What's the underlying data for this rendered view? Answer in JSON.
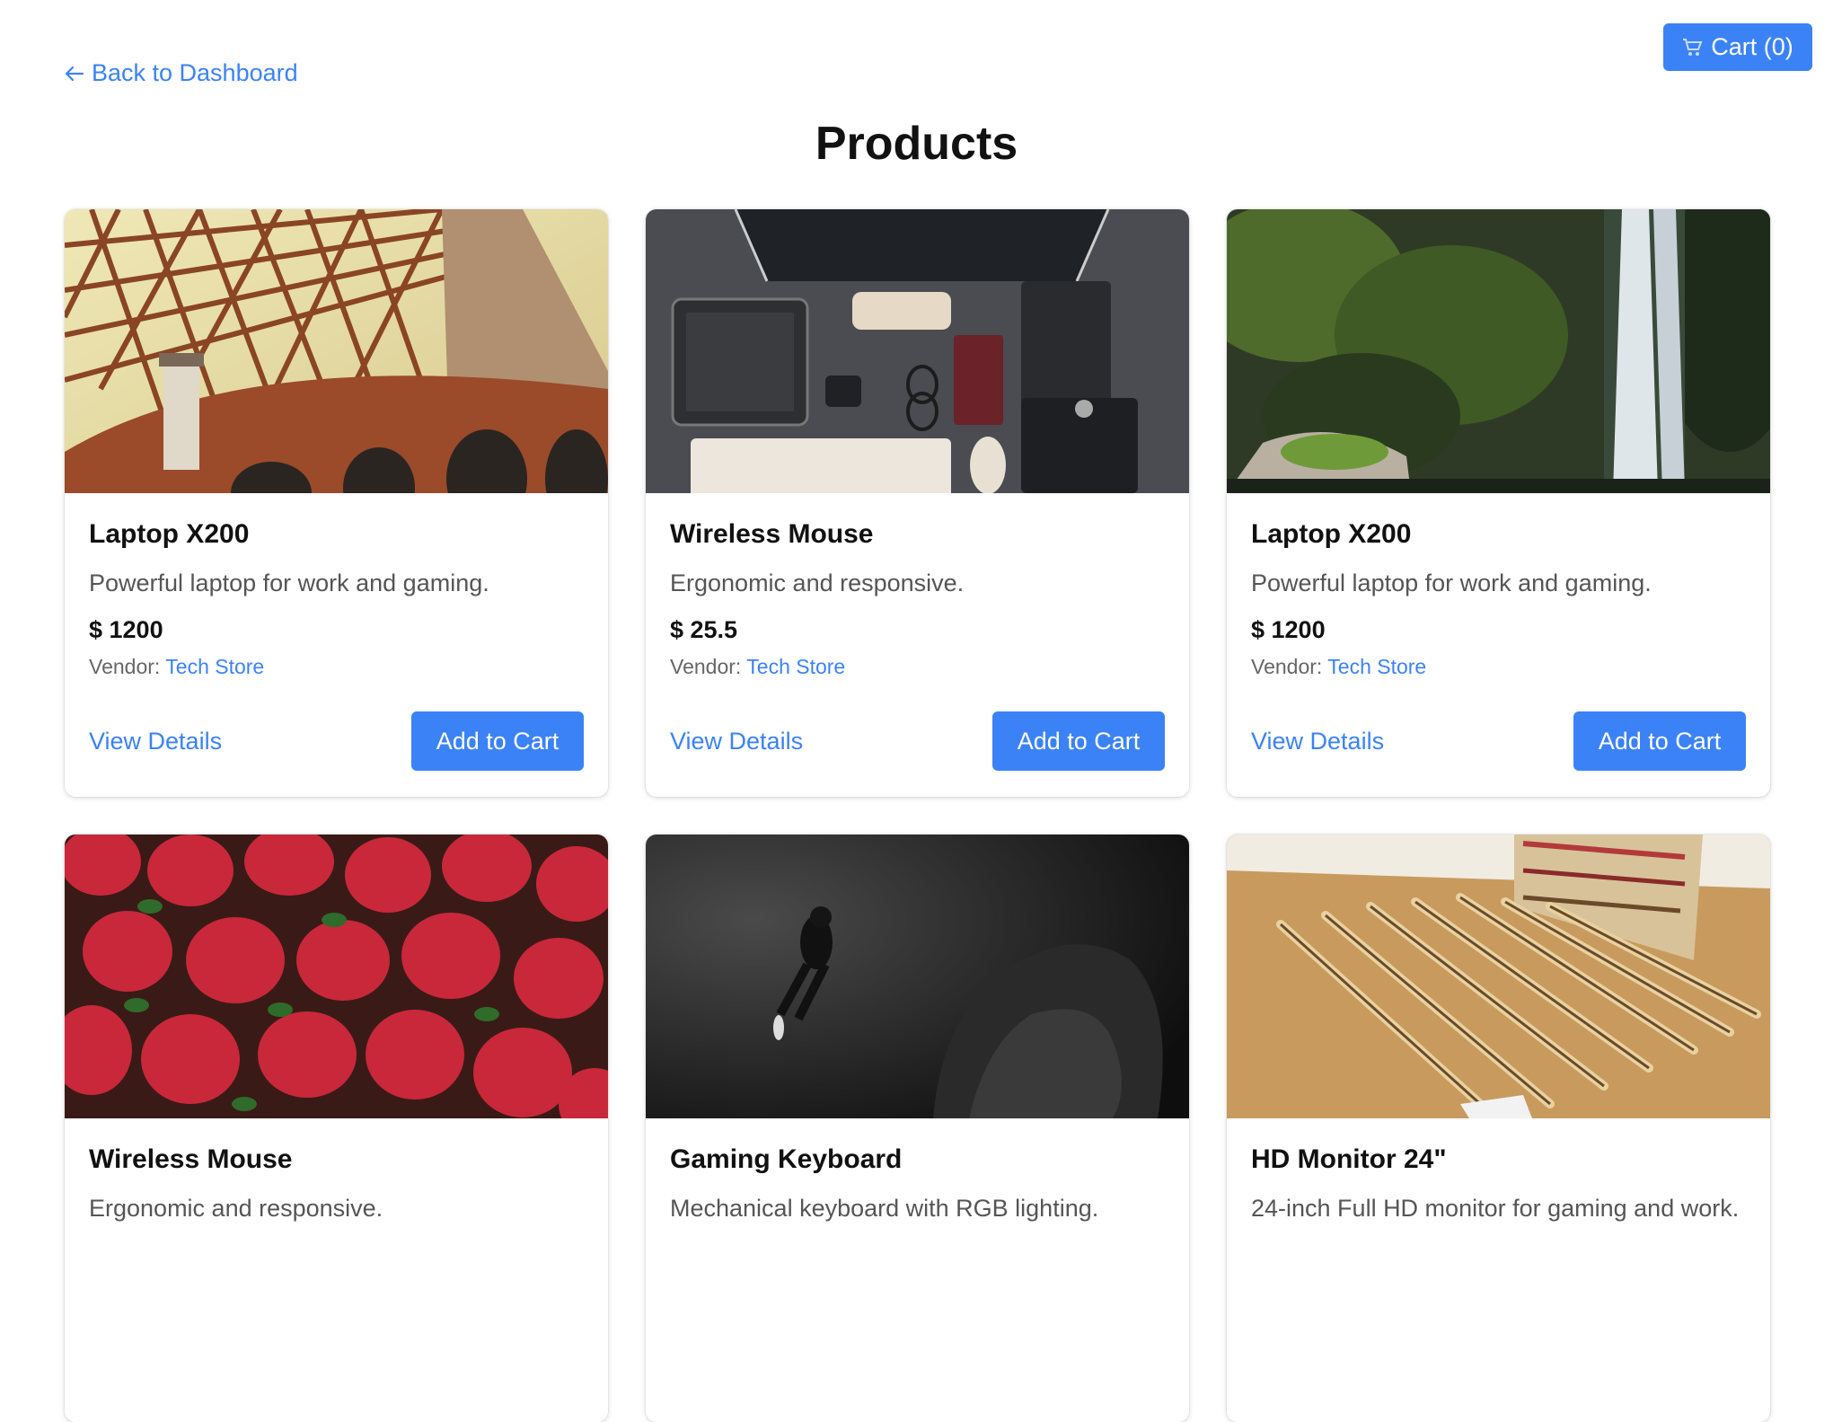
{
  "header": {
    "back_label": "Back to Dashboard",
    "cart_label": "Cart (0)",
    "page_title": "Products"
  },
  "colors": {
    "accent": "#3b82f6",
    "text": "#111111",
    "muted": "#555555"
  },
  "products": [
    {
      "name": "Laptop X200",
      "description": "Powerful laptop for work and gaming.",
      "price": "$ 1200",
      "vendor_label": "Vendor:",
      "vendor": "Tech Store",
      "view_label": "View Details",
      "add_label": "Add to Cart",
      "image": "bridge-photo"
    },
    {
      "name": "Wireless Mouse",
      "description": "Ergonomic and responsive.",
      "price": "$ 25.5",
      "vendor_label": "Vendor:",
      "vendor": "Tech Store",
      "view_label": "View Details",
      "add_label": "Add to Cart",
      "image": "desk-setup-photo"
    },
    {
      "name": "Laptop X200",
      "description": "Powerful laptop for work and gaming.",
      "price": "$ 1200",
      "vendor_label": "Vendor:",
      "vendor": "Tech Store",
      "view_label": "View Details",
      "add_label": "Add to Cart",
      "image": "waterfall-photo"
    },
    {
      "name": "Wireless Mouse",
      "description": "Ergonomic and responsive.",
      "image": "strawberries-photo"
    },
    {
      "name": "Gaming Keyboard",
      "description": "Mechanical keyboard with RGB lighting.",
      "image": "diver-photo"
    },
    {
      "name": "HD Monitor 24\"",
      "description": "24-inch Full HD monitor for gaming and work.",
      "image": "pencils-photo"
    }
  ]
}
